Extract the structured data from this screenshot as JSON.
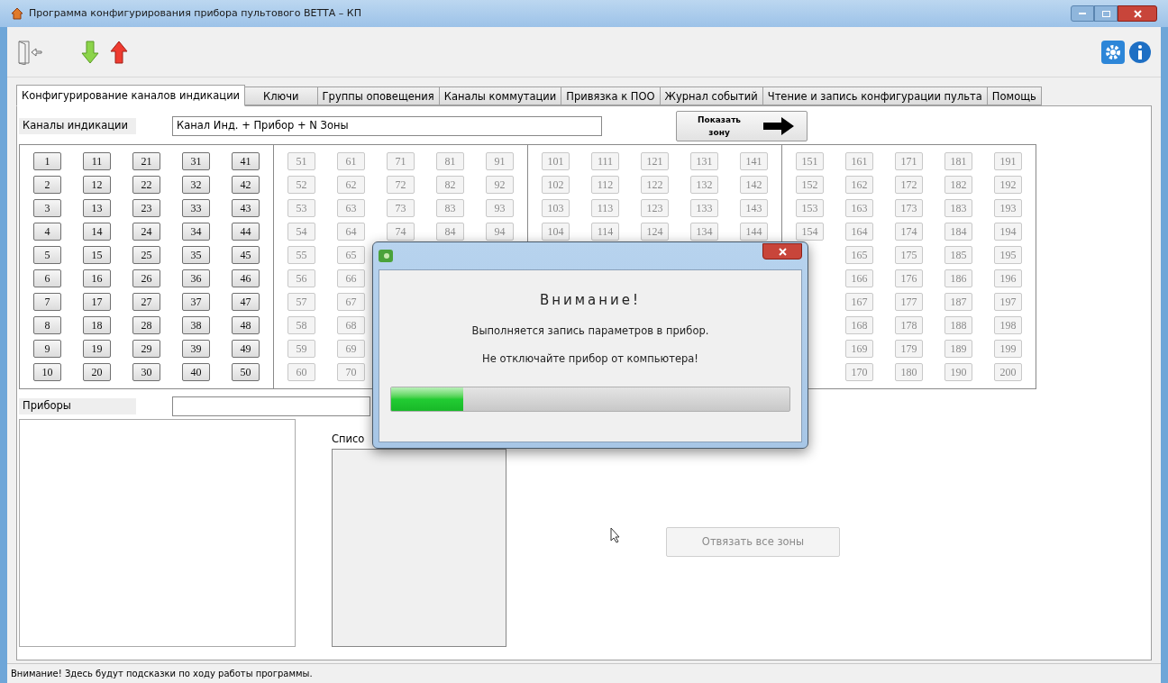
{
  "window": {
    "title": "Программа конфигурирования прибора пультового ВЕТТА – КП"
  },
  "tabs": [
    {
      "label": "Конфигурирование каналов индикации",
      "selected": true
    },
    {
      "label": "Ключи",
      "selected": false
    },
    {
      "label": "Группы оповещения",
      "selected": false
    },
    {
      "label": "Каналы коммутации",
      "selected": false
    },
    {
      "label": "Привязка к ПОО",
      "selected": false
    },
    {
      "label": "Журнал событий",
      "selected": false
    },
    {
      "label": "Чтение и запись конфигурации пульта",
      "selected": false
    },
    {
      "label": "Помощь",
      "selected": false
    }
  ],
  "channels": {
    "label": "Каналы индикации",
    "field_value": "Канал Инд. + Прибор + N Зоны",
    "show_button": "Показать зону"
  },
  "groups": [
    {
      "enabled": true,
      "rows": [
        [
          "1",
          "11",
          "21",
          "31",
          "41"
        ],
        [
          "2",
          "12",
          "22",
          "32",
          "42"
        ],
        [
          "3",
          "13",
          "23",
          "33",
          "43"
        ],
        [
          "4",
          "14",
          "24",
          "34",
          "44"
        ],
        [
          "5",
          "15",
          "25",
          "35",
          "45"
        ],
        [
          "6",
          "16",
          "26",
          "36",
          "46"
        ],
        [
          "7",
          "17",
          "27",
          "37",
          "47"
        ],
        [
          "8",
          "18",
          "28",
          "38",
          "48"
        ],
        [
          "9",
          "19",
          "29",
          "39",
          "49"
        ],
        [
          "10",
          "20",
          "30",
          "40",
          "50"
        ]
      ]
    },
    {
      "enabled": false,
      "rows": [
        [
          "51",
          "61",
          "71",
          "81",
          "91"
        ],
        [
          "52",
          "62",
          "72",
          "82",
          "92"
        ],
        [
          "53",
          "63",
          "73",
          "83",
          "93"
        ],
        [
          "54",
          "64",
          "74",
          "84",
          "94"
        ],
        [
          "55",
          "65",
          null,
          null,
          null
        ],
        [
          "56",
          "66",
          null,
          null,
          null
        ],
        [
          "57",
          "67",
          null,
          null,
          null
        ],
        [
          "58",
          "68",
          null,
          null,
          null
        ],
        [
          "59",
          "69",
          null,
          null,
          null
        ],
        [
          "60",
          "70",
          null,
          null,
          null
        ]
      ]
    },
    {
      "enabled": false,
      "rows": [
        [
          "101",
          "111",
          "121",
          "131",
          "141"
        ],
        [
          "102",
          "112",
          "122",
          "132",
          "142"
        ],
        [
          "103",
          "113",
          "123",
          "133",
          "143"
        ],
        [
          "104",
          "114",
          "124",
          "134",
          "144"
        ],
        [
          null,
          null,
          null,
          null,
          null
        ],
        [
          null,
          null,
          null,
          null,
          null
        ],
        [
          null,
          null,
          null,
          null,
          null
        ],
        [
          null,
          null,
          null,
          null,
          null
        ],
        [
          null,
          null,
          null,
          null,
          null
        ],
        [
          null,
          null,
          null,
          null,
          null
        ]
      ]
    },
    {
      "enabled": false,
      "rows": [
        [
          "151",
          "161",
          "171",
          "181",
          "191"
        ],
        [
          "152",
          "162",
          "172",
          "182",
          "192"
        ],
        [
          "153",
          "163",
          "173",
          "183",
          "193"
        ],
        [
          "154",
          "164",
          "174",
          "184",
          "194"
        ],
        [
          null,
          "165",
          "175",
          "185",
          "195"
        ],
        [
          null,
          "166",
          "176",
          "186",
          "196"
        ],
        [
          null,
          "167",
          "177",
          "187",
          "197"
        ],
        [
          null,
          "168",
          "178",
          "188",
          "198"
        ],
        [
          null,
          "169",
          "179",
          "189",
          "199"
        ],
        [
          null,
          "170",
          "180",
          "190",
          "200"
        ]
      ]
    }
  ],
  "devices": {
    "label": "Приборы"
  },
  "zones_list": {
    "label": "Списо"
  },
  "unbind_button": {
    "label": "Отвязать все зоны",
    "disabled": true
  },
  "dialog": {
    "heading": "Внимание!",
    "line_1": "Выполняется запись параметров в прибор.",
    "line_2": "Не отключайте прибор от компьютера!",
    "level": 0.18
  },
  "status_bar": "Внимание! Здесь будут подсказки по ходу работы программы."
}
